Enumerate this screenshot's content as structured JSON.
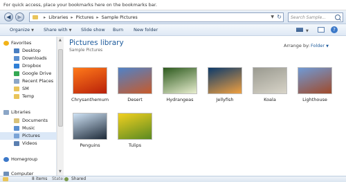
{
  "bookmarks_bar": {
    "text": "For quick access, place your bookmarks here on the bookmarks bar."
  },
  "address": {
    "crumbs": [
      "Libraries",
      "Pictures",
      "Sample Pictures"
    ]
  },
  "search": {
    "placeholder": "Search Sample..."
  },
  "commands": {
    "organize": "Organize",
    "share_with": "Share with",
    "slide_show": "Slide show",
    "burn": "Burn",
    "new_folder": "New folder"
  },
  "navpane": {
    "favorites_header": "Favorites",
    "favorites": [
      {
        "label": "Desktop",
        "icon": "desktop-icon",
        "color": "#4a7fc1"
      },
      {
        "label": "Downloads",
        "icon": "downloads-icon",
        "color": "#5a8fd0"
      },
      {
        "label": "Dropbox",
        "icon": "dropbox-icon",
        "color": "#2f7fd6"
      },
      {
        "label": "Google Drive",
        "icon": "google-drive-icon",
        "color": "#34a853"
      },
      {
        "label": "Recent Places",
        "icon": "recent-places-icon",
        "color": "#8ba6c7"
      },
      {
        "label": "SM",
        "icon": "folder-icon",
        "color": "#e9c45a"
      },
      {
        "label": "Temp",
        "icon": "folder-icon",
        "color": "#e9c45a"
      }
    ],
    "libraries_header": "Libraries",
    "libraries": [
      {
        "label": "Documents",
        "icon": "documents-icon",
        "color": "#d9c27a"
      },
      {
        "label": "Music",
        "icon": "music-icon",
        "color": "#5a8fd0"
      },
      {
        "label": "Pictures",
        "icon": "pictures-icon",
        "color": "#7aa3d6",
        "selected": true
      },
      {
        "label": "Videos",
        "icon": "videos-icon",
        "color": "#5a7fb0"
      }
    ],
    "homegroup": "Homegroup",
    "computer": "Computer"
  },
  "library": {
    "title": "Pictures library",
    "subtitle": "Sample Pictures",
    "arrange_label": "Arrange by:",
    "arrange_value": "Folder"
  },
  "pictures": [
    {
      "name": "Chrysanthemum",
      "colors": [
        "#ff7a1a",
        "#b8200a"
      ]
    },
    {
      "name": "Desert",
      "colors": [
        "#4f82c8",
        "#c85a2a"
      ]
    },
    {
      "name": "Hydrangeas",
      "colors": [
        "#2d5a1e",
        "#e8eecf"
      ]
    },
    {
      "name": "Jellyfish",
      "colors": [
        "#0c3a6b",
        "#f0a040"
      ]
    },
    {
      "name": "Koala",
      "colors": [
        "#9a9a90",
        "#d8d4c8"
      ]
    },
    {
      "name": "Lighthouse",
      "colors": [
        "#6f9ad6",
        "#a04a2a"
      ]
    },
    {
      "name": "Penguins",
      "colors": [
        "#cfe3f6",
        "#1e2a38"
      ]
    },
    {
      "name": "Tulips",
      "colors": [
        "#f2d020",
        "#5a8a20"
      ]
    }
  ],
  "status": {
    "items": "8 items",
    "state_label": "State:",
    "shared": "Shared"
  }
}
